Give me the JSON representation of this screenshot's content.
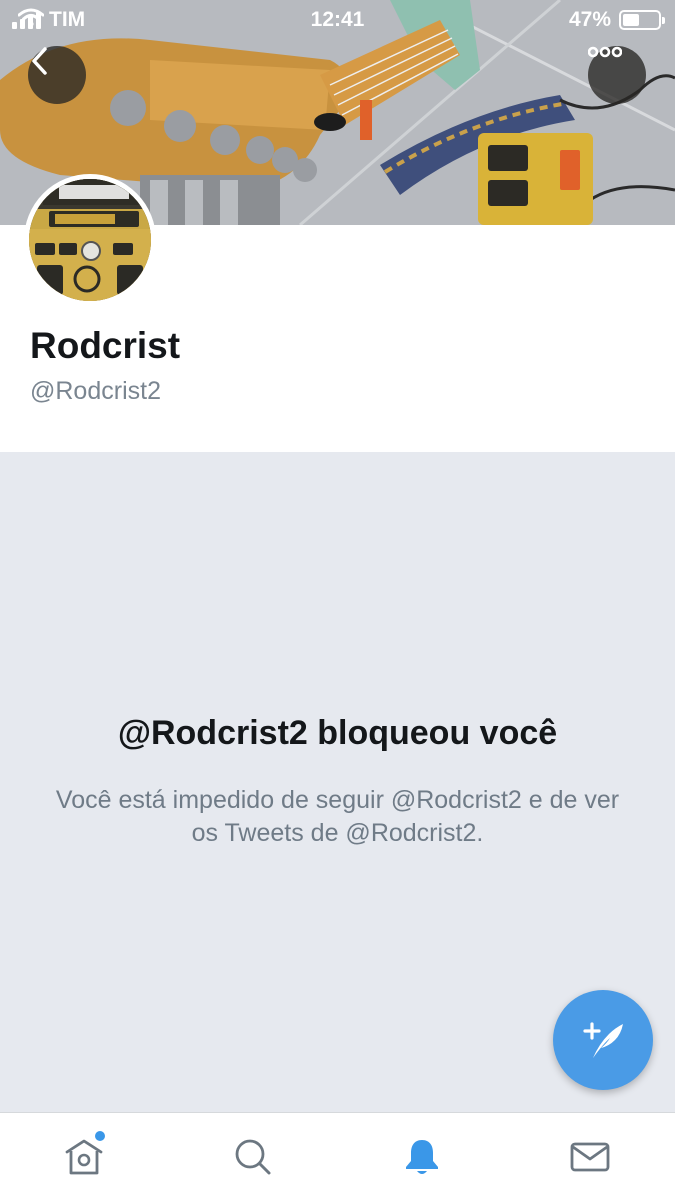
{
  "status_bar": {
    "carrier": "TIM",
    "time": "12:41",
    "battery_percent": "47%",
    "battery_level": 0.47,
    "signal_bars": 4
  },
  "header": {
    "back_icon": "chevron-left-icon",
    "more_icon": "more-horizontal-icon"
  },
  "profile": {
    "display_name": "Rodcrist",
    "handle": "@Rodcrist2"
  },
  "blocked": {
    "title": "@Rodcrist2 bloqueou você",
    "description": "Você está impedido de seguir @Rodcrist2 e de ver os Tweets de @Rodcrist2."
  },
  "fab": {
    "icon": "compose-tweet-icon"
  },
  "tab_bar": {
    "tabs": [
      {
        "name": "home",
        "icon": "home-icon",
        "has_badge": true,
        "active": false
      },
      {
        "name": "search",
        "icon": "search-icon",
        "active": false
      },
      {
        "name": "notifications",
        "icon": "bell-icon",
        "active": true
      },
      {
        "name": "messages",
        "icon": "envelope-icon",
        "active": false
      }
    ]
  },
  "colors": {
    "accent": "#4a9be6",
    "active_tab": "#3a97e8",
    "panel_bg": "#e6e9ef",
    "secondary_text": "#6f7b87"
  }
}
